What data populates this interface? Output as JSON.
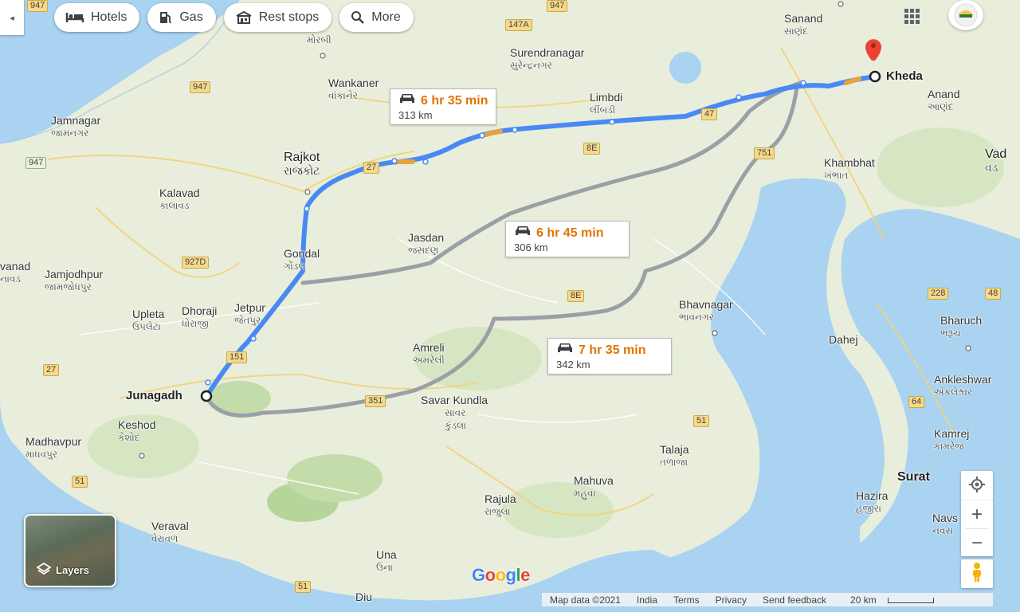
{
  "toolbar": {
    "collapse_glyph": "◂",
    "chips": [
      {
        "label": "Hotels",
        "icon": "bed-icon"
      },
      {
        "label": "Gas",
        "icon": "gas-pump-icon"
      },
      {
        "label": "Rest stops",
        "icon": "rest-stop-icon"
      },
      {
        "label": "More",
        "icon": "search-icon"
      }
    ]
  },
  "places": {
    "morbi_gu": "મોરબી",
    "surendranagar": "Surendranagar",
    "surendranagar_gu": "સુરેન્દ્રનગર",
    "wankaner": "Wankaner",
    "wankaner_gu": "વાંકાનેર",
    "limbdi": "Limbdi",
    "limbdi_gu": "લીંબડી",
    "sanand": "Sanand",
    "sanand_gu": "સાણંદ",
    "kheda": "Kheda",
    "anand": "Anand",
    "anand_gu": "આણંદ",
    "jamnagar": "Jamnagar",
    "jamnagar_gu": "જામનગર",
    "rajkot": "Rajkot",
    "rajkot_gu": "રાજકોટ",
    "khambhat": "Khambhat",
    "khambhat_gu": "ખંભાત",
    "vad": "Vad",
    "vad_gu": "વડ",
    "kalavad": "Kalavad",
    "kalavad_gu": "કાલાવડ",
    "jasdan": "Jasdan",
    "jasdan_gu": "જસદણ",
    "vanad": "vanad",
    "vanad_gu": "નાવડ",
    "jamjodhpur": "Jamjodhpur",
    "jamjodhpur_gu": "જામજોધપુર",
    "gondal": "Gondal",
    "gondal_gu": "ગોંડલ",
    "upleta": "Upleta",
    "upleta_gu": "ઉપલેટા",
    "dhoraji": "Dhoraji",
    "dhoraji_gu": "ધોરાજી",
    "jetpur": "Jetpur",
    "jetpur_gu": "જેતપુર",
    "bhavnagar": "Bhavnagar",
    "bhavnagar_gu": "ભાવનગર",
    "bharuch": "Bharuch",
    "bharuch_gu": "ભરૂચ",
    "dahej": "Dahej",
    "amreli": "Amreli",
    "amreli_gu": "અમરેલી",
    "ankleshwar": "Ankleshwar",
    "ankleshwar_gu": "અંકલેશ્વર",
    "junagadh": "Junagadh",
    "savar_kundla": "Savar Kundla",
    "savar_gu": "સાવર",
    "kundla_gu": "કુંડલા",
    "keshod": "Keshod",
    "keshod_gu": "કેશોદ",
    "madhavpur": "Madhavpur",
    "madhavpur_gu": "માધવપુર",
    "kamrej": "Kamrej",
    "kamrej_gu": "કામરેજ",
    "talaja": "Talaja",
    "talaja_gu": "તળાજા",
    "surat": "Surat",
    "hazira": "Hazira",
    "hazira_gu": "હજીરા",
    "mahuva": "Mahuva",
    "mahuva_gu": "મહુવા",
    "rajula": "Rajula",
    "rajula_gu": "રાજુલા",
    "navs": "Navs",
    "navs_gu": "નવસ",
    "veraval": "Veraval",
    "veraval_gu": "વેરાવળ",
    "una": "Una",
    "una_gu": "ઉના",
    "diu": "Diu"
  },
  "shields": {
    "s947a": "947",
    "s147a": "147A",
    "s947b": "947",
    "s947c": "947",
    "s47": "47",
    "s27a": "27",
    "s8e": "8E",
    "s751": "751",
    "s927d": "927D",
    "s8e2": "8E",
    "s228": "228",
    "s48": "48",
    "s151": "151",
    "s27b": "27",
    "s351": "351",
    "s51a": "51",
    "s64": "64",
    "s51b": "51",
    "s51c": "51"
  },
  "routes": [
    {
      "time": "6 hr 35 min",
      "distance": "313 km"
    },
    {
      "time": "6 hr 45 min",
      "distance": "306 km"
    },
    {
      "time": "7 hr 35 min",
      "distance": "342 km"
    }
  ],
  "layers_label": "Layers",
  "footer": {
    "map_data": "Map data ©2021",
    "country": "India",
    "terms": "Terms",
    "privacy": "Privacy",
    "feedback": "Send feedback",
    "scale": "20 km"
  },
  "colors": {
    "route_primary": "#4a89f3",
    "route_alt": "#9aa0a6",
    "traffic": "#e8a33d",
    "destination_pin": "#ea4335"
  }
}
